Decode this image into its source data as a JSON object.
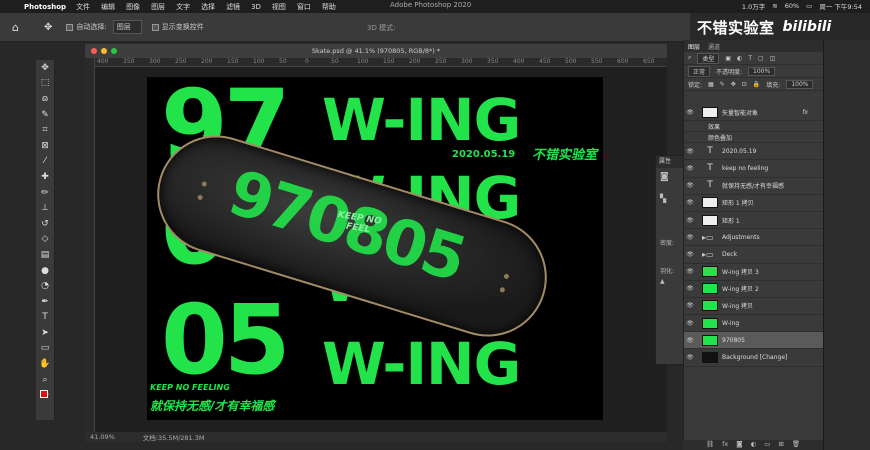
{
  "menubar": {
    "app": "Photoshop",
    "items": [
      "文件",
      "编辑",
      "图像",
      "图层",
      "文字",
      "选择",
      "滤镜",
      "3D",
      "视图",
      "窗口",
      "帮助"
    ],
    "window_title": "Adobe Photoshop 2020",
    "word_count": "1.0万字",
    "battery": "60%",
    "clock": "周一 下午9:54"
  },
  "watermark": {
    "text": "不错实验室",
    "brand": "bilibili"
  },
  "options": {
    "auto_select_label": "自动选择:",
    "auto_select_value": "图层",
    "show_transform_label": "显示变换控件",
    "mode_3d": "3D 模式:"
  },
  "document": {
    "tab_title": "Skate.psd @ 41.1% (970805, RGB/8*) *",
    "ruler_ticks": [
      "400",
      "350",
      "300",
      "250",
      "200",
      "150",
      "100",
      "50",
      "0",
      "50",
      "100",
      "150",
      "200",
      "250",
      "300",
      "350",
      "400",
      "450",
      "500",
      "550",
      "600",
      "650"
    ],
    "zoom": "41.09%",
    "doc_size": "文档:35.5M/281.3M"
  },
  "artwork": {
    "num_top": "97",
    "num_mid": "08",
    "num_bot": "05",
    "wing": "W-ING",
    "date": "2020.05.19",
    "brand": "不错实验室",
    "keep": "KEEP NO FEELING",
    "slogan": "就保持无感/才有幸福感",
    "board_number": "970805",
    "board_graffiti": "KEEP NO FEEL"
  },
  "properties": {
    "title": "属性",
    "density_label": "密度:",
    "feather_label": "羽化:"
  },
  "layers_panel": {
    "tab_layers": "图层",
    "tab_channels": "通道",
    "filter_label": "类型",
    "blend_mode": "正常",
    "opacity_label": "不透明度:",
    "opacity_value": "100%",
    "lock_label": "锁定:",
    "fill_label": "填充:",
    "fill_value": "100%",
    "layers": [
      {
        "name": "矢量智能对象",
        "kind": "smart",
        "fx": "fx"
      },
      {
        "name": "效果",
        "kind": "sub"
      },
      {
        "name": "颜色叠加",
        "kind": "sub"
      },
      {
        "name": "2020.05.19",
        "kind": "text"
      },
      {
        "name": "keep no feeling",
        "kind": "text"
      },
      {
        "name": "就保持无感/才有幸福感",
        "kind": "text"
      },
      {
        "name": "矩形 1 拷贝",
        "kind": "shape"
      },
      {
        "name": "矩形 1",
        "kind": "shape"
      },
      {
        "name": "Adjustments",
        "kind": "group"
      },
      {
        "name": "Deck",
        "kind": "group"
      },
      {
        "name": "W-ing 拷贝 3",
        "kind": "green"
      },
      {
        "name": "W-ing 拷贝 2",
        "kind": "green"
      },
      {
        "name": "W-ing 拷贝",
        "kind": "green"
      },
      {
        "name": "W-ing",
        "kind": "green"
      },
      {
        "name": "970805",
        "kind": "green",
        "selected": true
      },
      {
        "name": "Background [Change]",
        "kind": "black"
      }
    ]
  },
  "colors": {
    "accent_green": "#22e34a",
    "foreground": "#e01010",
    "background": "#ffffff"
  }
}
